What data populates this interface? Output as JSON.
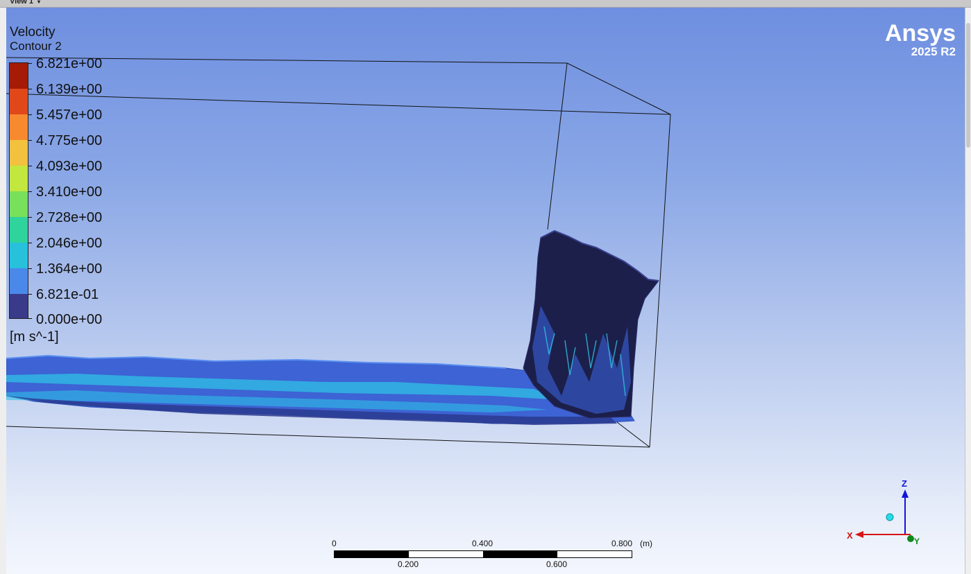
{
  "window": {
    "view_tab": "View 1"
  },
  "legend": {
    "title": "Velocity",
    "subtitle": "Contour 2",
    "ticks": [
      "6.821e+00",
      "6.139e+00",
      "5.457e+00",
      "4.775e+00",
      "4.093e+00",
      "3.410e+00",
      "2.728e+00",
      "2.046e+00",
      "1.364e+00",
      "6.821e-01",
      "0.000e+00"
    ],
    "units": "[m s^-1]",
    "band_colors": [
      "#a61b06",
      "#e0481a",
      "#f78a2f",
      "#f2c23e",
      "#c2e73e",
      "#78e05a",
      "#2fd39c",
      "#27c1dc",
      "#4a89ea",
      "#3a3a8a"
    ]
  },
  "brand": {
    "name": "Ansys",
    "version": "2025 R2"
  },
  "scale": {
    "labels_top": [
      "0",
      "0.400",
      "0.800"
    ],
    "labels_bottom": [
      "0.200",
      "0.600"
    ],
    "unit": "(m)"
  },
  "axes": {
    "x": "X",
    "y": "Y",
    "z": "Z"
  },
  "colors": {
    "background_top": "#6e8fe0",
    "background_bottom": "#f3f6fd",
    "water_dark": "#1c1f4a",
    "water_mid": "#3d63d4",
    "water_light": "#2fc0e6"
  }
}
